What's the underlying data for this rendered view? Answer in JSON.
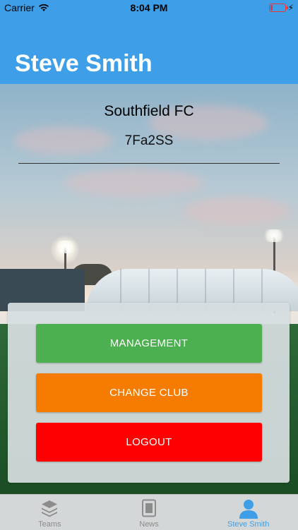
{
  "status_bar": {
    "carrier": "Carrier",
    "time": "8:04 PM"
  },
  "header": {
    "title": "Steve Smith"
  },
  "club": {
    "name": "Southfield FC",
    "code": "7Fa2SS"
  },
  "actions": {
    "management": {
      "label": "MANAGEMENT",
      "color": "#4caf50"
    },
    "change_club": {
      "label": "CHANGE CLUB",
      "color": "#f57c00"
    },
    "logout": {
      "label": "LOGOUT",
      "color": "#ff0000"
    }
  },
  "tabbar": {
    "tabs": [
      {
        "label": "Teams",
        "icon": "layers-icon",
        "active": false
      },
      {
        "label": "News",
        "icon": "newspaper-icon",
        "active": false
      },
      {
        "label": "Steve Smith",
        "icon": "person-icon",
        "active": true
      }
    ]
  },
  "colors": {
    "accent": "#3e9fe8",
    "tab_inactive": "#8c8c8c"
  }
}
